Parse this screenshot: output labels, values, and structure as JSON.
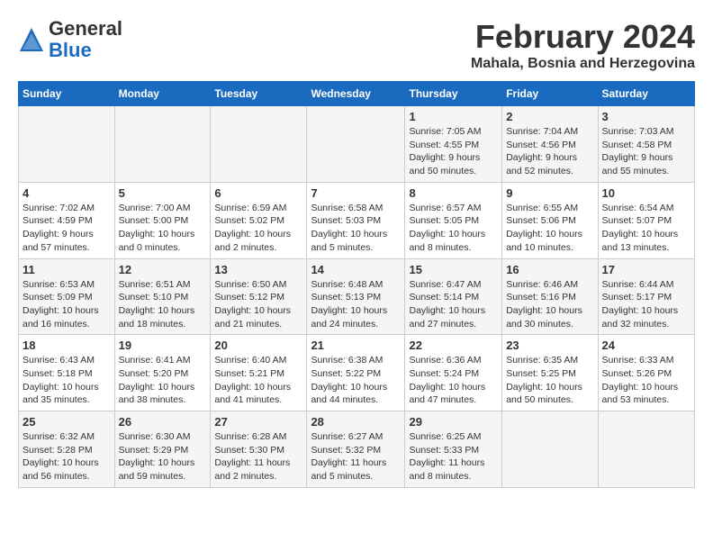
{
  "header": {
    "logo_line1": "General",
    "logo_line2": "Blue",
    "month": "February 2024",
    "location": "Mahala, Bosnia and Herzegovina"
  },
  "days_of_week": [
    "Sunday",
    "Monday",
    "Tuesday",
    "Wednesday",
    "Thursday",
    "Friday",
    "Saturday"
  ],
  "weeks": [
    [
      {
        "day": "",
        "info": ""
      },
      {
        "day": "",
        "info": ""
      },
      {
        "day": "",
        "info": ""
      },
      {
        "day": "",
        "info": ""
      },
      {
        "day": "1",
        "info": "Sunrise: 7:05 AM\nSunset: 4:55 PM\nDaylight: 9 hours\nand 50 minutes."
      },
      {
        "day": "2",
        "info": "Sunrise: 7:04 AM\nSunset: 4:56 PM\nDaylight: 9 hours\nand 52 minutes."
      },
      {
        "day": "3",
        "info": "Sunrise: 7:03 AM\nSunset: 4:58 PM\nDaylight: 9 hours\nand 55 minutes."
      }
    ],
    [
      {
        "day": "4",
        "info": "Sunrise: 7:02 AM\nSunset: 4:59 PM\nDaylight: 9 hours\nand 57 minutes."
      },
      {
        "day": "5",
        "info": "Sunrise: 7:00 AM\nSunset: 5:00 PM\nDaylight: 10 hours\nand 0 minutes."
      },
      {
        "day": "6",
        "info": "Sunrise: 6:59 AM\nSunset: 5:02 PM\nDaylight: 10 hours\nand 2 minutes."
      },
      {
        "day": "7",
        "info": "Sunrise: 6:58 AM\nSunset: 5:03 PM\nDaylight: 10 hours\nand 5 minutes."
      },
      {
        "day": "8",
        "info": "Sunrise: 6:57 AM\nSunset: 5:05 PM\nDaylight: 10 hours\nand 8 minutes."
      },
      {
        "day": "9",
        "info": "Sunrise: 6:55 AM\nSunset: 5:06 PM\nDaylight: 10 hours\nand 10 minutes."
      },
      {
        "day": "10",
        "info": "Sunrise: 6:54 AM\nSunset: 5:07 PM\nDaylight: 10 hours\nand 13 minutes."
      }
    ],
    [
      {
        "day": "11",
        "info": "Sunrise: 6:53 AM\nSunset: 5:09 PM\nDaylight: 10 hours\nand 16 minutes."
      },
      {
        "day": "12",
        "info": "Sunrise: 6:51 AM\nSunset: 5:10 PM\nDaylight: 10 hours\nand 18 minutes."
      },
      {
        "day": "13",
        "info": "Sunrise: 6:50 AM\nSunset: 5:12 PM\nDaylight: 10 hours\nand 21 minutes."
      },
      {
        "day": "14",
        "info": "Sunrise: 6:48 AM\nSunset: 5:13 PM\nDaylight: 10 hours\nand 24 minutes."
      },
      {
        "day": "15",
        "info": "Sunrise: 6:47 AM\nSunset: 5:14 PM\nDaylight: 10 hours\nand 27 minutes."
      },
      {
        "day": "16",
        "info": "Sunrise: 6:46 AM\nSunset: 5:16 PM\nDaylight: 10 hours\nand 30 minutes."
      },
      {
        "day": "17",
        "info": "Sunrise: 6:44 AM\nSunset: 5:17 PM\nDaylight: 10 hours\nand 32 minutes."
      }
    ],
    [
      {
        "day": "18",
        "info": "Sunrise: 6:43 AM\nSunset: 5:18 PM\nDaylight: 10 hours\nand 35 minutes."
      },
      {
        "day": "19",
        "info": "Sunrise: 6:41 AM\nSunset: 5:20 PM\nDaylight: 10 hours\nand 38 minutes."
      },
      {
        "day": "20",
        "info": "Sunrise: 6:40 AM\nSunset: 5:21 PM\nDaylight: 10 hours\nand 41 minutes."
      },
      {
        "day": "21",
        "info": "Sunrise: 6:38 AM\nSunset: 5:22 PM\nDaylight: 10 hours\nand 44 minutes."
      },
      {
        "day": "22",
        "info": "Sunrise: 6:36 AM\nSunset: 5:24 PM\nDaylight: 10 hours\nand 47 minutes."
      },
      {
        "day": "23",
        "info": "Sunrise: 6:35 AM\nSunset: 5:25 PM\nDaylight: 10 hours\nand 50 minutes."
      },
      {
        "day": "24",
        "info": "Sunrise: 6:33 AM\nSunset: 5:26 PM\nDaylight: 10 hours\nand 53 minutes."
      }
    ],
    [
      {
        "day": "25",
        "info": "Sunrise: 6:32 AM\nSunset: 5:28 PM\nDaylight: 10 hours\nand 56 minutes."
      },
      {
        "day": "26",
        "info": "Sunrise: 6:30 AM\nSunset: 5:29 PM\nDaylight: 10 hours\nand 59 minutes."
      },
      {
        "day": "27",
        "info": "Sunrise: 6:28 AM\nSunset: 5:30 PM\nDaylight: 11 hours\nand 2 minutes."
      },
      {
        "day": "28",
        "info": "Sunrise: 6:27 AM\nSunset: 5:32 PM\nDaylight: 11 hours\nand 5 minutes."
      },
      {
        "day": "29",
        "info": "Sunrise: 6:25 AM\nSunset: 5:33 PM\nDaylight: 11 hours\nand 8 minutes."
      },
      {
        "day": "",
        "info": ""
      },
      {
        "day": "",
        "info": ""
      }
    ]
  ]
}
